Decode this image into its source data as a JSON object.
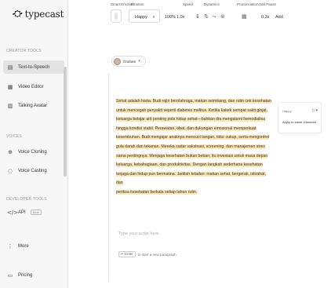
{
  "brand": {
    "logo_text": "typecast"
  },
  "sidebar": {
    "creator_label": "CREATOR TOOLS",
    "voices_label": "VOICES",
    "developer_label": "DEVELOPER TOOLS",
    "items": [
      {
        "label": "Text-to-Speech",
        "icon": "tts-icon",
        "active": true
      },
      {
        "label": "Video Editor",
        "icon": "video-icon"
      },
      {
        "label": "Talking Avatar",
        "icon": "avatar-icon"
      },
      {
        "label": "Voice Cloning",
        "icon": "clone-icon"
      },
      {
        "label": "Voice Casting",
        "icon": "casting-icon"
      },
      {
        "label": "API",
        "badge": "Beta",
        "icon": "api-icon"
      },
      {
        "label": "More",
        "icon": "more-icon"
      },
      {
        "label": "Pricing",
        "icon": "pricing-icon"
      }
    ]
  },
  "toolbar": {
    "smart_emotion_label": "Smart Emotion",
    "emotion_label": "Emotion",
    "emotion_value": "Happy",
    "emotion_intensity": "100%",
    "speed_label": "Speed",
    "speed_value": "1.0x",
    "dynamics_label": "Dynamics",
    "pronunciation_label": "Pronunciation",
    "add_pause_label": "Add Pause",
    "pause_value": "0.3s",
    "add_label": "Add"
  },
  "editor": {
    "speaker_name": "Graham",
    "script_lines": [
      "Sehat adalah harta. Budi rajin berolahraga, makan seimbang, dan rutin cek kesehatan",
      "untuk mencegah penyakit seperti diabetes melitus. Ketika kakek sempat sakit ginjal,",
      "keluarga belajar arti penting pola hidup sehat—bahkan dia mengalami hemodialisa",
      "hingga kondisi stabil. Perawatan, obat, dan dukungan emosional memperkuat",
      "kesembuhan. Budi mengajar anaknya mencuci tangan, tidur cukup, serta mengontrol",
      "gula darah dan tekanan. Mereka sadar vaksinasi, screening, dan manajemen stres",
      "sama pentingnya. Menjaga kesehatan bukan beban; itu investasi untuk masa depan",
      "keluarga, kebahagiaan, dan produktivitas. Dengan langkah sederhana kesehatan",
      "terjaga dan hidup pun bermakna. Jadilah teladan: makan sehat, bergerak, istirahat, dan",
      "periksa kesehatan berkala setiap tahun rutin."
    ],
    "placeholder": "Type your script here.",
    "hint_key": "Enter",
    "hint_text": "to start a new paragraph"
  },
  "side_card": {
    "emotion_label": "Happy",
    "apply_label": "Apply to same character"
  },
  "colors": {
    "highlight": "#fde7b3",
    "sidebar_bg": "#f7f7f7",
    "active_item": "#e3e3e3"
  }
}
